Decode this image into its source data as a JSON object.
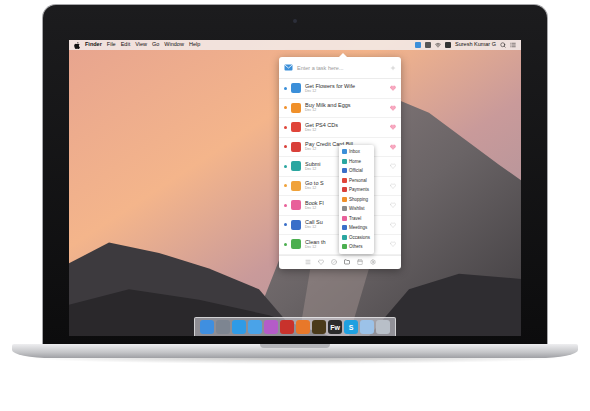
{
  "menu_bar": {
    "app": "Finder",
    "menus": [
      "File",
      "Edit",
      "View",
      "Go",
      "Window",
      "Help"
    ],
    "user": "Suresh Kumar G"
  },
  "popover": {
    "input_placeholder": "Enter a task here...",
    "tasks": [
      {
        "title": "Get Flowers for Wife",
        "date": "Dec 12",
        "color": "#3b8fd9",
        "favorite": true
      },
      {
        "title": "Buy Milk and Eggs",
        "date": "Dec 12",
        "color": "#f0902a",
        "favorite": true
      },
      {
        "title": "Get PS4 CDs",
        "date": "Dec 12",
        "color": "#e0453a",
        "favorite": true
      },
      {
        "title": "Pay Credit Card Bill",
        "date": "Dec 12",
        "color": "#d9403a",
        "favorite": true
      },
      {
        "title": "Submi",
        "date": "Dec 12",
        "color": "#2aa6a0",
        "favorite": false
      },
      {
        "title": "Go to S",
        "date": "Dec 12",
        "color": "#f0a23a",
        "favorite": false
      },
      {
        "title": "Book Fl",
        "date": "Dec 12",
        "color": "#e8609a",
        "favorite": false
      },
      {
        "title": "Call Su",
        "date": "Dec 12",
        "color": "#3a6fc9",
        "favorite": false
      },
      {
        "title": "Clean th",
        "date": "Dec 12",
        "color": "#4caf50",
        "favorite": false
      }
    ],
    "category_menu": [
      {
        "label": "Inbox",
        "color": "#3b8fd9"
      },
      {
        "label": "Home",
        "color": "#2aa6a0"
      },
      {
        "label": "Official",
        "color": "#3a6fc9"
      },
      {
        "label": "Personal",
        "color": "#e0453a"
      },
      {
        "label": "Payments",
        "color": "#d9403a"
      },
      {
        "label": "Shopping",
        "color": "#f0902a"
      },
      {
        "label": "Wishlist",
        "color": "#8a8a8a"
      },
      {
        "label": "Travel",
        "color": "#e8609a"
      },
      {
        "label": "Meetings",
        "color": "#3a6fc9"
      },
      {
        "label": "Occasions",
        "color": "#2aa6a0"
      },
      {
        "label": "Others",
        "color": "#4caf50"
      }
    ]
  },
  "dock": [
    {
      "color": "#3f8fe0"
    },
    {
      "color": "#7d8591"
    },
    {
      "color": "#2f9be6"
    },
    {
      "color": "#4aa3e8"
    },
    {
      "color": "#b45cc8"
    },
    {
      "color": "#c8322c"
    },
    {
      "color": "#e8782a"
    },
    {
      "color": "#4a3a1a"
    },
    {
      "color": "#2b2b2b",
      "label": "Fw"
    },
    {
      "color": "#1fa0e0",
      "label": "S"
    },
    {
      "color": "#9cc2e8"
    },
    {
      "color": "#b8bfc8"
    }
  ]
}
